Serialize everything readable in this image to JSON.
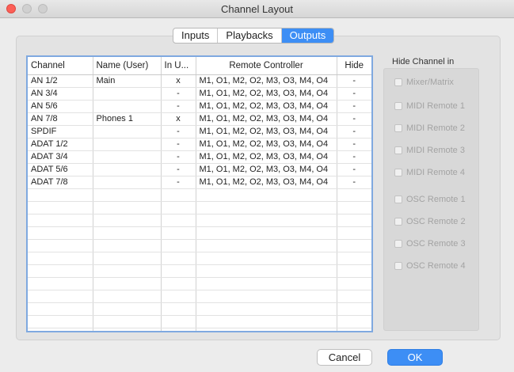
{
  "window": {
    "title": "Channel Layout"
  },
  "tabs": [
    {
      "label": "Inputs",
      "active": false
    },
    {
      "label": "Playbacks",
      "active": false
    },
    {
      "label": "Outputs",
      "active": true
    }
  ],
  "table": {
    "columns": [
      "Channel",
      "Name (User)",
      "In U...",
      "Remote Controller",
      "Hide"
    ],
    "rows": [
      [
        "AN 1/2",
        "Main",
        "x",
        "M1, O1, M2, O2, M3, O3, M4, O4",
        "-"
      ],
      [
        "AN 3/4",
        "",
        "-",
        "M1, O1, M2, O2, M3, O3, M4, O4",
        "-"
      ],
      [
        "AN 5/6",
        "",
        "-",
        "M1, O1, M2, O2, M3, O3, M4, O4",
        "-"
      ],
      [
        "AN 7/8",
        "Phones 1",
        "x",
        "M1, O1, M2, O2, M3, O3, M4, O4",
        "-"
      ],
      [
        "SPDIF",
        "",
        "-",
        "M1, O1, M2, O2, M3, O3, M4, O4",
        "-"
      ],
      [
        "ADAT 1/2",
        "",
        "-",
        "M1, O1, M2, O2, M3, O3, M4, O4",
        "-"
      ],
      [
        "ADAT 3/4",
        "",
        "-",
        "M1, O1, M2, O2, M3, O3, M4, O4",
        "-"
      ],
      [
        "ADAT 5/6",
        "",
        "-",
        "M1, O1, M2, O2, M3, O3, M4, O4",
        "-"
      ],
      [
        "ADAT 7/8",
        "",
        "-",
        "M1, O1, M2, O2, M3, O3, M4, O4",
        "-"
      ]
    ]
  },
  "hide_channel": {
    "label": "Hide Channel in",
    "options": [
      {
        "name": "mixer-matrix",
        "label": "Mixer/Matrix"
      },
      {
        "name": "midi-remote-1",
        "label": "MIDI Remote 1"
      },
      {
        "name": "midi-remote-2",
        "label": "MIDI Remote 2"
      },
      {
        "name": "midi-remote-3",
        "label": "MIDI Remote 3"
      },
      {
        "name": "midi-remote-4",
        "label": "MIDI Remote 4"
      },
      {
        "name": "osc-remote-1",
        "label": "OSC Remote 1"
      },
      {
        "name": "osc-remote-2",
        "label": "OSC Remote 2"
      },
      {
        "name": "osc-remote-3",
        "label": "OSC Remote 3"
      },
      {
        "name": "osc-remote-4",
        "label": "OSC Remote 4"
      }
    ]
  },
  "buttons": {
    "cancel": "Cancel",
    "ok": "OK"
  },
  "colors": {
    "accent": "#3d8ef5",
    "close": "#fc5f57",
    "table_border": "#7fa9e0"
  }
}
